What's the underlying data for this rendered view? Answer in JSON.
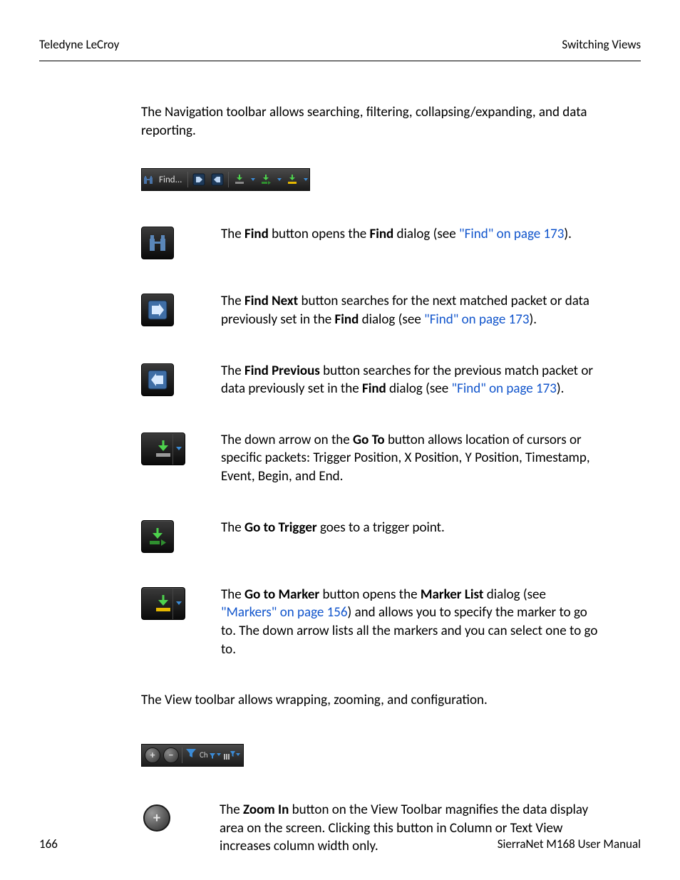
{
  "header": {
    "left": "Teledyne LeCroy",
    "right": "Switching Views"
  },
  "footer": {
    "page_number": "166",
    "manual_title": "SierraNet M168 User Manual"
  },
  "intro_nav": "The Navigation toolbar allows searching, filtering, collapsing/expanding, and data reporting.",
  "nav_toolbar": {
    "find_label": "Find..."
  },
  "rows": {
    "find": {
      "pre": "The ",
      "b1": "Find",
      "mid": " button opens the ",
      "b2": "Find",
      "post": " dialog (see ",
      "link": "\"Find\" on page 173",
      "after": ")."
    },
    "find_next": {
      "pre": "The ",
      "b1": "Find Next",
      "mid": " button searches for the next matched packet or data previously set in the ",
      "b2": "Find",
      "post": " dialog (see ",
      "link": "\"Find\" on page 173",
      "after": ")."
    },
    "find_prev": {
      "pre": "The ",
      "b1": "Find Previous",
      "mid": " button searches for the previous match packet or data previously set in the ",
      "b2": "Find",
      "post": " dialog (see ",
      "link": "\"Find\" on page 173",
      "after": ")."
    },
    "goto": {
      "pre": "The down arrow on the ",
      "b1": "Go To",
      "post": " button allows location of cursors or specific packets: Trigger Position, X Position, Y Position, Timestamp, Event, Begin, and End."
    },
    "gototrigger": {
      "pre": "The ",
      "b1": "Go to Trigger",
      "post": " goes to a trigger point."
    },
    "gotomarker": {
      "pre": "The ",
      "b1": "Go to Marker",
      "mid": " button opens the ",
      "b2": "Marker List",
      "post": " dialog (see ",
      "link": "\"Markers\" on page 156",
      "after": ") and allows you to specify the marker to go to. The down arrow lists all the markers and you can select one to go to."
    }
  },
  "intro_view": "The View toolbar allows wrapping, zooming, and configuration.",
  "view_toolbar": {
    "ch_label": "Ch"
  },
  "zoom_in": {
    "pre": "The ",
    "b1": "Zoom In",
    "post": " button on the View Toolbar magnifies the data display area on the screen. Clicking this button in Column or Text View increases column width only."
  }
}
